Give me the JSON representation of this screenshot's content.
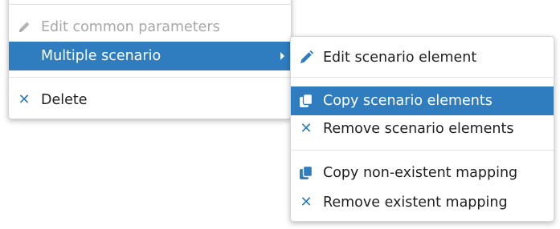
{
  "main_menu": {
    "items": [
      {
        "label": "Edit common parameters",
        "icon": "pencil-icon",
        "disabled": true
      },
      {
        "label": "Multiple scenario",
        "icon": "",
        "active": true,
        "has_submenu": true
      },
      {
        "label": "Delete",
        "icon": "close-icon"
      }
    ]
  },
  "submenu": {
    "items": [
      {
        "label": "Edit scenario element",
        "icon": "pencil-icon"
      },
      {
        "label": "Copy scenario elements",
        "icon": "copy-icon",
        "active": true
      },
      {
        "label": "Remove scenario elements",
        "icon": "close-icon"
      },
      {
        "label": "Copy non-existent mapping",
        "icon": "copy-icon"
      },
      {
        "label": "Remove existent mapping",
        "icon": "close-icon"
      }
    ]
  },
  "colors": {
    "accent": "#2f7dbe",
    "disabled_text": "#a8a8a8",
    "text": "#1f1f1f"
  }
}
